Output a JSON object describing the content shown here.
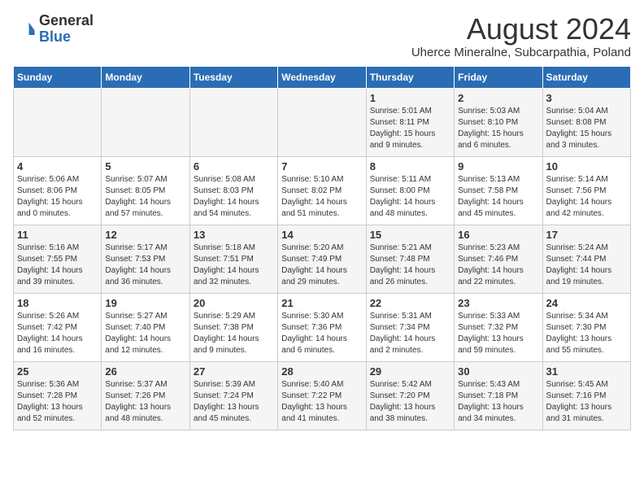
{
  "logo": {
    "general": "General",
    "blue": "Blue"
  },
  "title": "August 2024",
  "subtitle": "Uherce Mineralne, Subcarpathia, Poland",
  "weekdays": [
    "Sunday",
    "Monday",
    "Tuesday",
    "Wednesday",
    "Thursday",
    "Friday",
    "Saturday"
  ],
  "weeks": [
    [
      {
        "day": "",
        "info": ""
      },
      {
        "day": "",
        "info": ""
      },
      {
        "day": "",
        "info": ""
      },
      {
        "day": "",
        "info": ""
      },
      {
        "day": "1",
        "info": "Sunrise: 5:01 AM\nSunset: 8:11 PM\nDaylight: 15 hours\nand 9 minutes."
      },
      {
        "day": "2",
        "info": "Sunrise: 5:03 AM\nSunset: 8:10 PM\nDaylight: 15 hours\nand 6 minutes."
      },
      {
        "day": "3",
        "info": "Sunrise: 5:04 AM\nSunset: 8:08 PM\nDaylight: 15 hours\nand 3 minutes."
      }
    ],
    [
      {
        "day": "4",
        "info": "Sunrise: 5:06 AM\nSunset: 8:06 PM\nDaylight: 15 hours\nand 0 minutes."
      },
      {
        "day": "5",
        "info": "Sunrise: 5:07 AM\nSunset: 8:05 PM\nDaylight: 14 hours\nand 57 minutes."
      },
      {
        "day": "6",
        "info": "Sunrise: 5:08 AM\nSunset: 8:03 PM\nDaylight: 14 hours\nand 54 minutes."
      },
      {
        "day": "7",
        "info": "Sunrise: 5:10 AM\nSunset: 8:02 PM\nDaylight: 14 hours\nand 51 minutes."
      },
      {
        "day": "8",
        "info": "Sunrise: 5:11 AM\nSunset: 8:00 PM\nDaylight: 14 hours\nand 48 minutes."
      },
      {
        "day": "9",
        "info": "Sunrise: 5:13 AM\nSunset: 7:58 PM\nDaylight: 14 hours\nand 45 minutes."
      },
      {
        "day": "10",
        "info": "Sunrise: 5:14 AM\nSunset: 7:56 PM\nDaylight: 14 hours\nand 42 minutes."
      }
    ],
    [
      {
        "day": "11",
        "info": "Sunrise: 5:16 AM\nSunset: 7:55 PM\nDaylight: 14 hours\nand 39 minutes."
      },
      {
        "day": "12",
        "info": "Sunrise: 5:17 AM\nSunset: 7:53 PM\nDaylight: 14 hours\nand 36 minutes."
      },
      {
        "day": "13",
        "info": "Sunrise: 5:18 AM\nSunset: 7:51 PM\nDaylight: 14 hours\nand 32 minutes."
      },
      {
        "day": "14",
        "info": "Sunrise: 5:20 AM\nSunset: 7:49 PM\nDaylight: 14 hours\nand 29 minutes."
      },
      {
        "day": "15",
        "info": "Sunrise: 5:21 AM\nSunset: 7:48 PM\nDaylight: 14 hours\nand 26 minutes."
      },
      {
        "day": "16",
        "info": "Sunrise: 5:23 AM\nSunset: 7:46 PM\nDaylight: 14 hours\nand 22 minutes."
      },
      {
        "day": "17",
        "info": "Sunrise: 5:24 AM\nSunset: 7:44 PM\nDaylight: 14 hours\nand 19 minutes."
      }
    ],
    [
      {
        "day": "18",
        "info": "Sunrise: 5:26 AM\nSunset: 7:42 PM\nDaylight: 14 hours\nand 16 minutes."
      },
      {
        "day": "19",
        "info": "Sunrise: 5:27 AM\nSunset: 7:40 PM\nDaylight: 14 hours\nand 12 minutes."
      },
      {
        "day": "20",
        "info": "Sunrise: 5:29 AM\nSunset: 7:38 PM\nDaylight: 14 hours\nand 9 minutes."
      },
      {
        "day": "21",
        "info": "Sunrise: 5:30 AM\nSunset: 7:36 PM\nDaylight: 14 hours\nand 6 minutes."
      },
      {
        "day": "22",
        "info": "Sunrise: 5:31 AM\nSunset: 7:34 PM\nDaylight: 14 hours\nand 2 minutes."
      },
      {
        "day": "23",
        "info": "Sunrise: 5:33 AM\nSunset: 7:32 PM\nDaylight: 13 hours\nand 59 minutes."
      },
      {
        "day": "24",
        "info": "Sunrise: 5:34 AM\nSunset: 7:30 PM\nDaylight: 13 hours\nand 55 minutes."
      }
    ],
    [
      {
        "day": "25",
        "info": "Sunrise: 5:36 AM\nSunset: 7:28 PM\nDaylight: 13 hours\nand 52 minutes."
      },
      {
        "day": "26",
        "info": "Sunrise: 5:37 AM\nSunset: 7:26 PM\nDaylight: 13 hours\nand 48 minutes."
      },
      {
        "day": "27",
        "info": "Sunrise: 5:39 AM\nSunset: 7:24 PM\nDaylight: 13 hours\nand 45 minutes."
      },
      {
        "day": "28",
        "info": "Sunrise: 5:40 AM\nSunset: 7:22 PM\nDaylight: 13 hours\nand 41 minutes."
      },
      {
        "day": "29",
        "info": "Sunrise: 5:42 AM\nSunset: 7:20 PM\nDaylight: 13 hours\nand 38 minutes."
      },
      {
        "day": "30",
        "info": "Sunrise: 5:43 AM\nSunset: 7:18 PM\nDaylight: 13 hours\nand 34 minutes."
      },
      {
        "day": "31",
        "info": "Sunrise: 5:45 AM\nSunset: 7:16 PM\nDaylight: 13 hours\nand 31 minutes."
      }
    ]
  ]
}
